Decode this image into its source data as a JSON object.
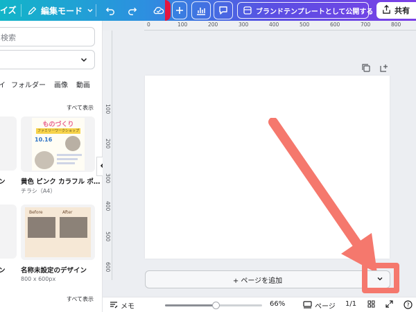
{
  "topbar": {
    "resize_label": "イズ",
    "mode_label": "編集モード",
    "publish_label": "ブランドテンプレートとして公開する",
    "share_label": "共有",
    "icons": [
      "pencil-icon",
      "chevron-down-icon",
      "undo-icon",
      "redo-icon",
      "cloud-icon",
      "plus-icon",
      "chart-icon",
      "comment-icon",
      "upload-icon"
    ]
  },
  "sidebar": {
    "search_placeholder": "検索",
    "tabs": [
      "イ",
      "フォルダー",
      "画像",
      "動画"
    ],
    "show_all_1": "すべて表示",
    "show_all_2": "すべて表示",
    "cards": [
      {
        "title": "ン",
        "sub": ""
      },
      {
        "title": "黄色 ピンク カラフル ポ…",
        "sub": "チラシ（A4）"
      },
      {
        "title": "ン",
        "sub": ""
      },
      {
        "title": "名称未設定のデザイン",
        "sub": "800 x 600px"
      }
    ],
    "flyer": {
      "line1": "ものづくり",
      "line2": "ファミリーワークショップ",
      "date": "10.16"
    },
    "before_label": "Before",
    "after_label": "After"
  },
  "ruler": {
    "top": [
      "0",
      "100",
      "200",
      "300",
      "400",
      "500",
      "600",
      "700",
      "800"
    ],
    "left": [
      "100",
      "200",
      "300",
      "400",
      "500",
      "600"
    ]
  },
  "canvas": {
    "add_page_label": "+ ページを追加"
  },
  "bottombar": {
    "notes_label": "メモ",
    "zoom_label": "66%",
    "zoom_value": 66,
    "pages_label": "ページ",
    "page_count": "1/1"
  },
  "colors": {
    "highlight": "#f5786d",
    "gradient_start": "#12b5c8",
    "gradient_end": "#7b3fe6"
  }
}
